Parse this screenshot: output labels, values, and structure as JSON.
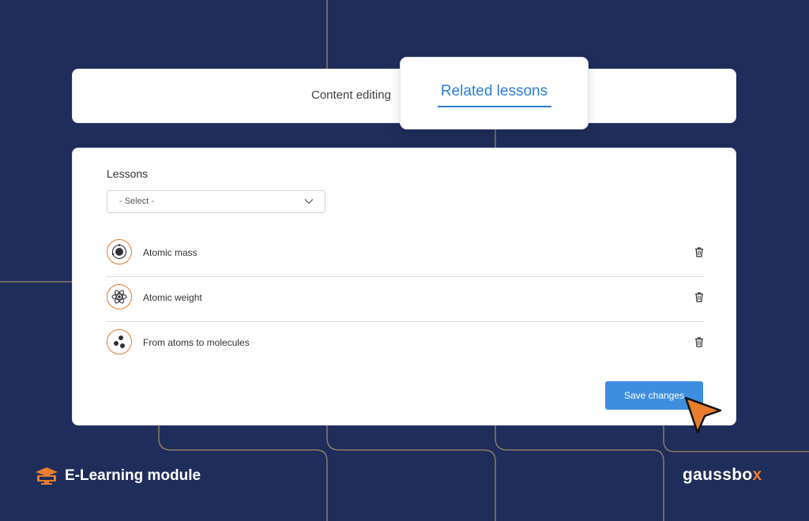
{
  "tabs": [
    {
      "label": "Content editing",
      "active": false
    },
    {
      "label": "Related lessons",
      "active": true
    }
  ],
  "form": {
    "lessons_label": "Lessons",
    "select_value": "- Select -"
  },
  "lessons": [
    {
      "title": "Atomic mass",
      "icon": "atom-orbit-icon"
    },
    {
      "title": "Atomic weight",
      "icon": "atom-icon"
    },
    {
      "title": "From atoms to molecules",
      "icon": "molecule-icon"
    }
  ],
  "actions": {
    "save_label": "Save changes"
  },
  "branding": {
    "module_label": "E-Learning module",
    "logo_text": "gaussbo",
    "logo_accent": "x"
  },
  "colors": {
    "background": "#1f2d5a",
    "accent_blue": "#2b7fd6",
    "button_blue": "#3e8ee0",
    "accent_orange": "#e07a33"
  }
}
